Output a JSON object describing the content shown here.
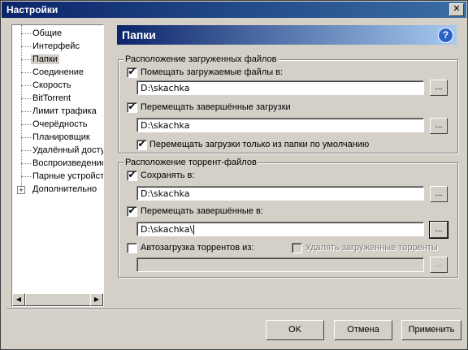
{
  "window": {
    "title": "Настройки",
    "close_glyph": "✕"
  },
  "tree": {
    "items": [
      {
        "label": "Общие"
      },
      {
        "label": "Интерфейс"
      },
      {
        "label": "Папки"
      },
      {
        "label": "Соединение"
      },
      {
        "label": "Скорость"
      },
      {
        "label": "BitTorrent"
      },
      {
        "label": "Лимит трафика"
      },
      {
        "label": "Очерёдность"
      },
      {
        "label": "Планировщик"
      },
      {
        "label": "Удалённый доступ"
      },
      {
        "label": "Воспроизведение"
      },
      {
        "label": "Парные устройства"
      },
      {
        "label": "Дополнительно"
      }
    ],
    "selected": "Папки",
    "expander_glyph": "+",
    "scroll_left": "◀",
    "scroll_right": "▶"
  },
  "panel": {
    "title": "Папки",
    "help_glyph": "?"
  },
  "downloads_group": {
    "legend": "Расположение загруженных файлов",
    "put_in": {
      "label": "Помещать загружаемые файлы в:",
      "checked": true,
      "path": "D:\\skachka"
    },
    "move_completed": {
      "label": "Перемещать завершённые загрузки",
      "checked": true,
      "path": "D:\\skachka"
    },
    "only_default": {
      "label": "Перемещать загрузки только из папки по умолчанию",
      "checked": true
    }
  },
  "torrents_group": {
    "legend": "Расположение торрент-файлов",
    "save_in": {
      "label": "Сохранять в:",
      "checked": true,
      "path": "D:\\skachka"
    },
    "move_completed": {
      "label": "Перемещать завершённые в:",
      "checked": true,
      "path": "D:\\skachka\\"
    },
    "autoload": {
      "label": "Автозагрузка торрентов из:",
      "checked": false,
      "path": ""
    },
    "delete_loaded": {
      "label": "Удалять загруженные торренты",
      "checked": false
    }
  },
  "browse_label": "...",
  "check_glyph": "✔",
  "buttons": {
    "ok": "OK",
    "cancel": "Отмена",
    "apply": "Применить"
  }
}
